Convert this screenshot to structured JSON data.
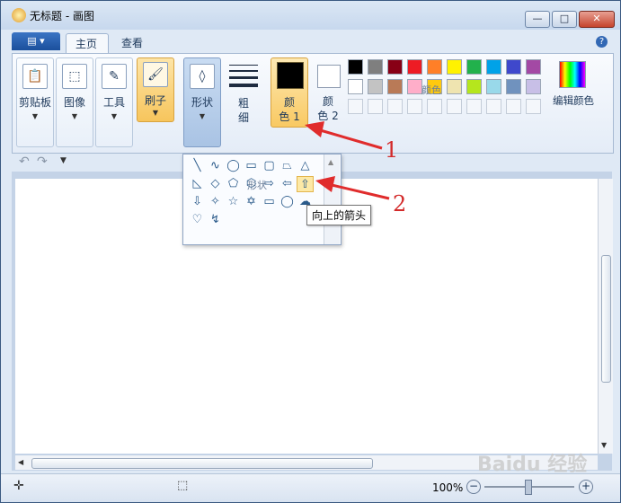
{
  "window": {
    "title": "无标题 - 画图"
  },
  "tabs": {
    "home": "主页",
    "view": "查看"
  },
  "ribbon": {
    "clipboard": "剪贴板",
    "image": "图像",
    "tools": "工具",
    "brushes": "刷子",
    "shapes": "形状",
    "size_top": "粗",
    "size_bottom": "细",
    "color1_top": "颜",
    "color1_bottom": "色 1",
    "color2_top": "颜",
    "color2_bottom": "色 2",
    "edit_colors": "编辑颜色",
    "colors_group": "颜色",
    "shapes_group": "形状"
  },
  "palette": {
    "row1": [
      "#000000",
      "#7f7f7f",
      "#880015",
      "#ed1c24",
      "#ff7f27",
      "#fff200",
      "#22b14c",
      "#00a2e8",
      "#3f48cc",
      "#a349a4"
    ],
    "row2": [
      "#ffffff",
      "#c3c3c3",
      "#b97a57",
      "#ffaec9",
      "#ffc90e",
      "#efe4b0",
      "#b5e61d",
      "#99d9ea",
      "#7092be",
      "#c8bfe7"
    ]
  },
  "shapes_popup": {
    "tooltip": "向上的箭头",
    "icons": [
      "line",
      "curve",
      "oval",
      "rectangle",
      "rounded-rectangle",
      "polygon",
      "triangle",
      "right-triangle",
      "diamond",
      "pentagon",
      "hexagon",
      "right-arrow",
      "left-arrow",
      "up-arrow",
      "down-arrow",
      "four-point-star",
      "five-point-star",
      "six-point-star",
      "rounded-callout",
      "oval-callout",
      "cloud-callout",
      "heart",
      "lightning"
    ]
  },
  "statusbar": {
    "zoom": "100%"
  },
  "annotations": {
    "one": "1",
    "two": "2"
  },
  "watermark": "Baidu 经验"
}
